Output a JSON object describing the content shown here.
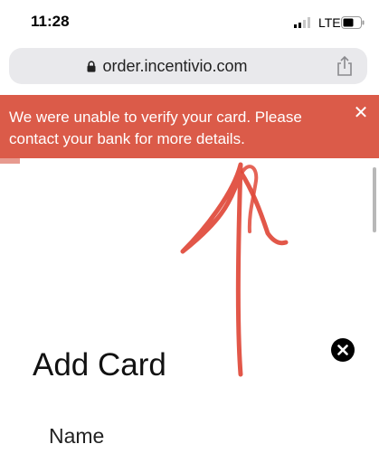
{
  "status_bar": {
    "time": "11:28",
    "carrier": "LTE",
    "icons": [
      "signal-icon",
      "battery-icon"
    ]
  },
  "browser": {
    "url": "order.incentivio.com",
    "icons": [
      "lock-icon",
      "share-icon"
    ]
  },
  "error_banner": {
    "message": "We were unable to verify your card. Please contact your bank for more details.",
    "close_glyph": "✕",
    "background_color": "#db5b49",
    "text_color": "#ffffff"
  },
  "annotation": {
    "color": "#e0493a"
  },
  "modal": {
    "title": "Add Card",
    "fields": [
      {
        "label": "Name"
      }
    ],
    "icons": [
      "close-icon"
    ]
  }
}
